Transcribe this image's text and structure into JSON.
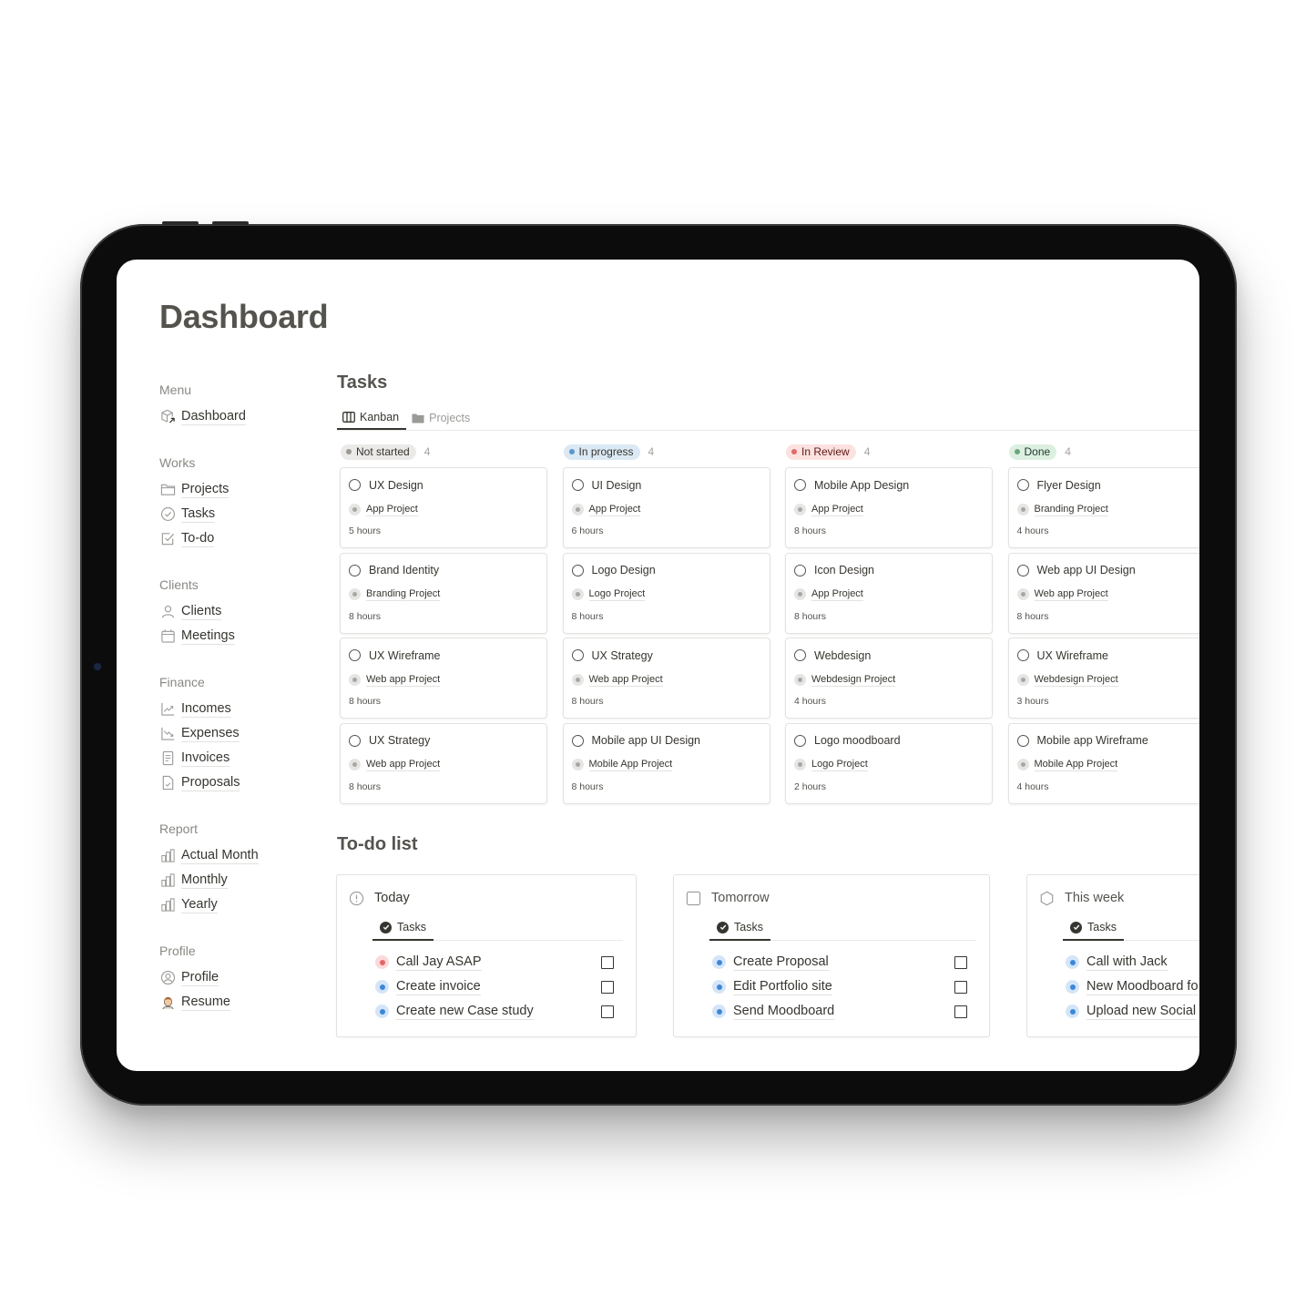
{
  "page": {
    "title": "Dashboard"
  },
  "sidebar": {
    "groups": [
      {
        "heading": "Menu",
        "items": [
          {
            "label": "Dashboard",
            "icon": "cube-arrow-icon"
          }
        ]
      },
      {
        "heading": "Works",
        "items": [
          {
            "label": "Projects",
            "icon": "folder-icon"
          },
          {
            "label": "Tasks",
            "icon": "check-circle-icon"
          },
          {
            "label": "To-do",
            "icon": "checkbox-icon"
          }
        ]
      },
      {
        "heading": "Clients",
        "items": [
          {
            "label": "Clients",
            "icon": "person-icon"
          },
          {
            "label": "Meetings",
            "icon": "calendar-icon"
          }
        ]
      },
      {
        "heading": "Finance",
        "items": [
          {
            "label": "Incomes",
            "icon": "chart-up-icon"
          },
          {
            "label": "Expenses",
            "icon": "chart-down-icon"
          },
          {
            "label": "Invoices",
            "icon": "document-icon"
          },
          {
            "label": "Proposals",
            "icon": "document-check-icon"
          }
        ]
      },
      {
        "heading": "Report",
        "items": [
          {
            "label": "Actual Month",
            "icon": "bar-chart-icon"
          },
          {
            "label": "Monthly",
            "icon": "bar-chart-icon"
          },
          {
            "label": "Yearly",
            "icon": "bar-chart-icon"
          }
        ]
      },
      {
        "heading": "Profile",
        "items": [
          {
            "label": "Profile",
            "icon": "user-circle-icon"
          },
          {
            "label": "Resume",
            "icon": "avatar-emoji-icon"
          }
        ]
      }
    ]
  },
  "tasks": {
    "title": "Tasks",
    "tabs": [
      {
        "label": "Kanban",
        "icon": "columns-icon",
        "active": true
      },
      {
        "label": "Projects",
        "icon": "folder-filled-icon",
        "active": false
      }
    ],
    "columns": [
      {
        "status": "Not started",
        "count": "4",
        "pill_bg": "#ebeae8",
        "dot": "#9b9a97",
        "text": "#37352f",
        "cards": [
          {
            "title": "UX Design",
            "project": "App Project",
            "hours": "5 hours"
          },
          {
            "title": "Brand Identity",
            "project": "Branding Project",
            "hours": "8 hours"
          },
          {
            "title": "UX Wireframe",
            "project": "Web app Project",
            "hours": "8 hours"
          },
          {
            "title": "UX Strategy",
            "project": "Web app Project",
            "hours": "8 hours"
          }
        ]
      },
      {
        "status": "In progress",
        "count": "4",
        "pill_bg": "#dbe9f4",
        "dot": "#5b97c9",
        "text": "#37352f",
        "cards": [
          {
            "title": "UI Design",
            "project": "App Project",
            "hours": "6 hours"
          },
          {
            "title": "Logo Design",
            "project": "Logo Project",
            "hours": "8 hours"
          },
          {
            "title": "UX Strategy",
            "project": "Web app Project",
            "hours": "8 hours"
          },
          {
            "title": "Mobile app UI Design",
            "project": "Mobile App Project",
            "hours": "8 hours"
          }
        ]
      },
      {
        "status": "In Review",
        "count": "4",
        "pill_bg": "#fbe2e0",
        "dot": "#e06b67",
        "text": "#5d1715",
        "cards": [
          {
            "title": "Mobile App Design",
            "project": "App Project",
            "hours": "8 hours"
          },
          {
            "title": "Icon Design",
            "project": "App Project",
            "hours": "8 hours"
          },
          {
            "title": "Webdesign",
            "project": "Webdesign Project",
            "hours": "4 hours"
          },
          {
            "title": "Logo moodboard",
            "project": "Logo Project",
            "hours": "2 hours"
          }
        ]
      },
      {
        "status": "Done",
        "count": "4",
        "pill_bg": "#dcefe1",
        "dot": "#6aa67d",
        "text": "#1c3829",
        "cards": [
          {
            "title": "Flyer Design",
            "project": "Branding Project",
            "hours": "4 hours"
          },
          {
            "title": "Web app UI Design",
            "project": "Web app Project",
            "hours": "8 hours"
          },
          {
            "title": "UX Wireframe",
            "project": "Webdesign Project",
            "hours": "3 hours"
          },
          {
            "title": "Mobile app Wireframe",
            "project": "Mobile App Project",
            "hours": "4 hours"
          }
        ]
      }
    ]
  },
  "todo": {
    "title": "To-do list",
    "panels": [
      {
        "heading": "Today",
        "icon": "alert-circle-icon",
        "tab": "Tasks",
        "items": [
          {
            "label": "Call Jay ASAP",
            "priority": "high",
            "color": "#e5646a",
            "bg": "#fbd9da",
            "checked": false
          },
          {
            "label": "Create invoice",
            "priority": "normal",
            "color": "#3d87d8",
            "bg": "#d4e5f7",
            "checked": false
          },
          {
            "label": "Create new Case study",
            "priority": "normal",
            "color": "#3d87d8",
            "bg": "#d4e5f7",
            "checked": false
          }
        ]
      },
      {
        "heading": "Tomorrow",
        "icon": "square-icon",
        "tab": "Tasks",
        "items": [
          {
            "label": "Create Proposal",
            "priority": "normal",
            "color": "#3d87d8",
            "bg": "#d4e5f7",
            "checked": false
          },
          {
            "label": "Edit Portfolio site",
            "priority": "normal",
            "color": "#3d87d8",
            "bg": "#d4e5f7",
            "checked": false
          },
          {
            "label": "Send Moodboard",
            "priority": "normal",
            "color": "#3d87d8",
            "bg": "#d4e5f7",
            "checked": false
          }
        ]
      },
      {
        "heading": "This week",
        "icon": "hexagon-icon",
        "tab": "Tasks",
        "items": [
          {
            "label": "Call with Jack",
            "priority": "normal",
            "color": "#3d87d8",
            "bg": "#d4e5f7",
            "checked": false
          },
          {
            "label": "New Moodboard fo",
            "priority": "normal",
            "color": "#3d87d8",
            "bg": "#d4e5f7",
            "checked": false
          },
          {
            "label": "Upload new Social",
            "priority": "normal",
            "color": "#3d87d8",
            "bg": "#d4e5f7",
            "checked": false
          }
        ]
      }
    ]
  }
}
